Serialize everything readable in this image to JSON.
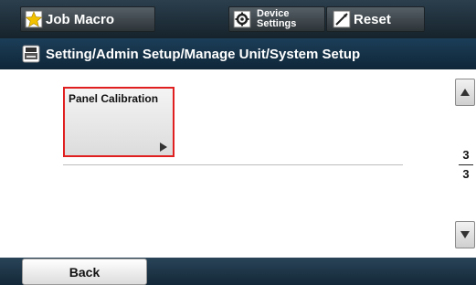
{
  "topbar": {
    "job_macro_label": "Job Macro",
    "device_settings_line1": "Device",
    "device_settings_line2": "Settings",
    "reset_label": "Reset"
  },
  "breadcrumb": {
    "path": "Setting/Admin Setup/Manage Unit/System Setup"
  },
  "main": {
    "tiles": [
      {
        "label": "Panel Calibration",
        "selected": true
      }
    ]
  },
  "pagination": {
    "current": "3",
    "total": "3"
  },
  "footer": {
    "back_label": "Back"
  },
  "colors": {
    "topbar": "#1f2f3a",
    "pathbar": "#163349",
    "selection_border": "#e02020",
    "star": "#f2c200"
  },
  "icons": {
    "job_macro": "star-icon",
    "device_settings": "device-settings-icon",
    "reset": "reset-icon",
    "breadcrumb": "printer-icon",
    "tile_arrow": "triangle-right-icon",
    "scroll_up": "triangle-up-icon",
    "scroll_down": "triangle-down-icon"
  }
}
